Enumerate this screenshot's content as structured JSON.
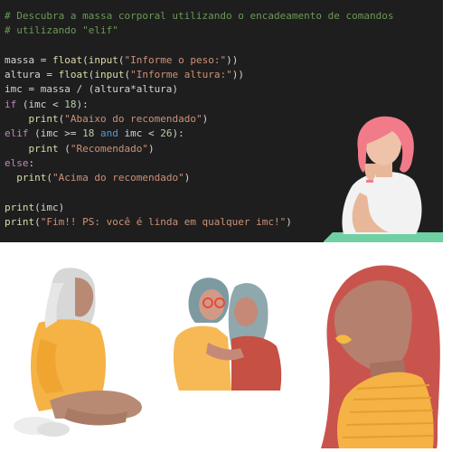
{
  "code": {
    "lines": [
      [
        {
          "t": "comment",
          "v": "# Descubra a massa corporal utilizando o encadeamento de comandos"
        }
      ],
      [
        {
          "t": "comment",
          "v": "# utilizando \"elif\""
        }
      ],
      [],
      [
        {
          "t": "plain",
          "v": "massa = "
        },
        {
          "t": "func",
          "v": "float"
        },
        {
          "t": "plain",
          "v": "("
        },
        {
          "t": "func",
          "v": "input"
        },
        {
          "t": "plain",
          "v": "("
        },
        {
          "t": "string",
          "v": "\"Informe o peso:\""
        },
        {
          "t": "plain",
          "v": "))"
        }
      ],
      [
        {
          "t": "plain",
          "v": "altura = "
        },
        {
          "t": "func",
          "v": "float"
        },
        {
          "t": "plain",
          "v": "("
        },
        {
          "t": "func",
          "v": "input"
        },
        {
          "t": "plain",
          "v": "("
        },
        {
          "t": "string",
          "v": "\"Informe altura:\""
        },
        {
          "t": "plain",
          "v": "))"
        }
      ],
      [
        {
          "t": "plain",
          "v": "imc = massa / (altura*altura)"
        }
      ],
      [
        {
          "t": "keyword",
          "v": "if"
        },
        {
          "t": "plain",
          "v": " (imc < "
        },
        {
          "t": "number",
          "v": "18"
        },
        {
          "t": "plain",
          "v": "):"
        }
      ],
      [
        {
          "t": "plain",
          "v": "    "
        },
        {
          "t": "func",
          "v": "print"
        },
        {
          "t": "plain",
          "v": "("
        },
        {
          "t": "string",
          "v": "\"Abaixo do recomendado\""
        },
        {
          "t": "plain",
          "v": ")"
        }
      ],
      [
        {
          "t": "keyword",
          "v": "elif"
        },
        {
          "t": "plain",
          "v": " (imc >= "
        },
        {
          "t": "number",
          "v": "18"
        },
        {
          "t": "plain",
          "v": " "
        },
        {
          "t": "op",
          "v": "and"
        },
        {
          "t": "plain",
          "v": " imc < "
        },
        {
          "t": "number",
          "v": "26"
        },
        {
          "t": "plain",
          "v": "):"
        }
      ],
      [
        {
          "t": "plain",
          "v": "    "
        },
        {
          "t": "func",
          "v": "print"
        },
        {
          "t": "plain",
          "v": " ("
        },
        {
          "t": "string",
          "v": "\"Recomendado\""
        },
        {
          "t": "plain",
          "v": ")"
        }
      ],
      [
        {
          "t": "keyword",
          "v": "else"
        },
        {
          "t": "plain",
          "v": ":"
        }
      ],
      [
        {
          "t": "plain",
          "v": "  "
        },
        {
          "t": "func",
          "v": "print"
        },
        {
          "t": "plain",
          "v": "("
        },
        {
          "t": "string",
          "v": "\"Acima do recomendado\""
        },
        {
          "t": "plain",
          "v": ")"
        }
      ],
      [],
      [
        {
          "t": "func",
          "v": "print"
        },
        {
          "t": "plain",
          "v": "(imc)"
        }
      ],
      [
        {
          "t": "func",
          "v": "print"
        },
        {
          "t": "plain",
          "v": "("
        },
        {
          "t": "string",
          "v": "\"Fim!! PS: você é linda em qualquer imc!\""
        },
        {
          "t": "plain",
          "v": ")"
        }
      ]
    ]
  },
  "colors": {
    "editor_bg": "#1e1e1e",
    "comment": "#6a9955",
    "string": "#ce9178",
    "keyword": "#c586c0",
    "function": "#dcdcaa",
    "number": "#b5cea8",
    "operator": "#569cd6",
    "text": "#d4d4d4"
  },
  "illustrations": [
    {
      "name": "woman-pink-hair-illustration"
    },
    {
      "name": "woman-white-hair-sitting-illustration"
    },
    {
      "name": "two-women-hugging-illustration"
    },
    {
      "name": "woman-red-hair-portrait-illustration"
    }
  ]
}
